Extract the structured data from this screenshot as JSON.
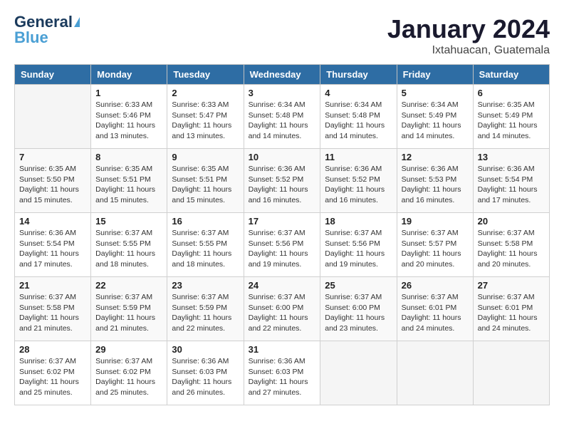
{
  "logo": {
    "line1": "General",
    "line2": "Blue"
  },
  "title": "January 2024",
  "subtitle": "Ixtahuacan, Guatemala",
  "days_of_week": [
    "Sunday",
    "Monday",
    "Tuesday",
    "Wednesday",
    "Thursday",
    "Friday",
    "Saturday"
  ],
  "weeks": [
    [
      {
        "day": "",
        "sunrise": "",
        "sunset": "",
        "daylight": ""
      },
      {
        "day": "1",
        "sunrise": "Sunrise: 6:33 AM",
        "sunset": "Sunset: 5:46 PM",
        "daylight": "Daylight: 11 hours and 13 minutes."
      },
      {
        "day": "2",
        "sunrise": "Sunrise: 6:33 AM",
        "sunset": "Sunset: 5:47 PM",
        "daylight": "Daylight: 11 hours and 13 minutes."
      },
      {
        "day": "3",
        "sunrise": "Sunrise: 6:34 AM",
        "sunset": "Sunset: 5:48 PM",
        "daylight": "Daylight: 11 hours and 14 minutes."
      },
      {
        "day": "4",
        "sunrise": "Sunrise: 6:34 AM",
        "sunset": "Sunset: 5:48 PM",
        "daylight": "Daylight: 11 hours and 14 minutes."
      },
      {
        "day": "5",
        "sunrise": "Sunrise: 6:34 AM",
        "sunset": "Sunset: 5:49 PM",
        "daylight": "Daylight: 11 hours and 14 minutes."
      },
      {
        "day": "6",
        "sunrise": "Sunrise: 6:35 AM",
        "sunset": "Sunset: 5:49 PM",
        "daylight": "Daylight: 11 hours and 14 minutes."
      }
    ],
    [
      {
        "day": "7",
        "sunrise": "Sunrise: 6:35 AM",
        "sunset": "Sunset: 5:50 PM",
        "daylight": "Daylight: 11 hours and 15 minutes."
      },
      {
        "day": "8",
        "sunrise": "Sunrise: 6:35 AM",
        "sunset": "Sunset: 5:51 PM",
        "daylight": "Daylight: 11 hours and 15 minutes."
      },
      {
        "day": "9",
        "sunrise": "Sunrise: 6:35 AM",
        "sunset": "Sunset: 5:51 PM",
        "daylight": "Daylight: 11 hours and 15 minutes."
      },
      {
        "day": "10",
        "sunrise": "Sunrise: 6:36 AM",
        "sunset": "Sunset: 5:52 PM",
        "daylight": "Daylight: 11 hours and 16 minutes."
      },
      {
        "day": "11",
        "sunrise": "Sunrise: 6:36 AM",
        "sunset": "Sunset: 5:52 PM",
        "daylight": "Daylight: 11 hours and 16 minutes."
      },
      {
        "day": "12",
        "sunrise": "Sunrise: 6:36 AM",
        "sunset": "Sunset: 5:53 PM",
        "daylight": "Daylight: 11 hours and 16 minutes."
      },
      {
        "day": "13",
        "sunrise": "Sunrise: 6:36 AM",
        "sunset": "Sunset: 5:54 PM",
        "daylight": "Daylight: 11 hours and 17 minutes."
      }
    ],
    [
      {
        "day": "14",
        "sunrise": "Sunrise: 6:36 AM",
        "sunset": "Sunset: 5:54 PM",
        "daylight": "Daylight: 11 hours and 17 minutes."
      },
      {
        "day": "15",
        "sunrise": "Sunrise: 6:37 AM",
        "sunset": "Sunset: 5:55 PM",
        "daylight": "Daylight: 11 hours and 18 minutes."
      },
      {
        "day": "16",
        "sunrise": "Sunrise: 6:37 AM",
        "sunset": "Sunset: 5:55 PM",
        "daylight": "Daylight: 11 hours and 18 minutes."
      },
      {
        "day": "17",
        "sunrise": "Sunrise: 6:37 AM",
        "sunset": "Sunset: 5:56 PM",
        "daylight": "Daylight: 11 hours and 19 minutes."
      },
      {
        "day": "18",
        "sunrise": "Sunrise: 6:37 AM",
        "sunset": "Sunset: 5:56 PM",
        "daylight": "Daylight: 11 hours and 19 minutes."
      },
      {
        "day": "19",
        "sunrise": "Sunrise: 6:37 AM",
        "sunset": "Sunset: 5:57 PM",
        "daylight": "Daylight: 11 hours and 20 minutes."
      },
      {
        "day": "20",
        "sunrise": "Sunrise: 6:37 AM",
        "sunset": "Sunset: 5:58 PM",
        "daylight": "Daylight: 11 hours and 20 minutes."
      }
    ],
    [
      {
        "day": "21",
        "sunrise": "Sunrise: 6:37 AM",
        "sunset": "Sunset: 5:58 PM",
        "daylight": "Daylight: 11 hours and 21 minutes."
      },
      {
        "day": "22",
        "sunrise": "Sunrise: 6:37 AM",
        "sunset": "Sunset: 5:59 PM",
        "daylight": "Daylight: 11 hours and 21 minutes."
      },
      {
        "day": "23",
        "sunrise": "Sunrise: 6:37 AM",
        "sunset": "Sunset: 5:59 PM",
        "daylight": "Daylight: 11 hours and 22 minutes."
      },
      {
        "day": "24",
        "sunrise": "Sunrise: 6:37 AM",
        "sunset": "Sunset: 6:00 PM",
        "daylight": "Daylight: 11 hours and 22 minutes."
      },
      {
        "day": "25",
        "sunrise": "Sunrise: 6:37 AM",
        "sunset": "Sunset: 6:00 PM",
        "daylight": "Daylight: 11 hours and 23 minutes."
      },
      {
        "day": "26",
        "sunrise": "Sunrise: 6:37 AM",
        "sunset": "Sunset: 6:01 PM",
        "daylight": "Daylight: 11 hours and 24 minutes."
      },
      {
        "day": "27",
        "sunrise": "Sunrise: 6:37 AM",
        "sunset": "Sunset: 6:01 PM",
        "daylight": "Daylight: 11 hours and 24 minutes."
      }
    ],
    [
      {
        "day": "28",
        "sunrise": "Sunrise: 6:37 AM",
        "sunset": "Sunset: 6:02 PM",
        "daylight": "Daylight: 11 hours and 25 minutes."
      },
      {
        "day": "29",
        "sunrise": "Sunrise: 6:37 AM",
        "sunset": "Sunset: 6:02 PM",
        "daylight": "Daylight: 11 hours and 25 minutes."
      },
      {
        "day": "30",
        "sunrise": "Sunrise: 6:36 AM",
        "sunset": "Sunset: 6:03 PM",
        "daylight": "Daylight: 11 hours and 26 minutes."
      },
      {
        "day": "31",
        "sunrise": "Sunrise: 6:36 AM",
        "sunset": "Sunset: 6:03 PM",
        "daylight": "Daylight: 11 hours and 27 minutes."
      },
      {
        "day": "",
        "sunrise": "",
        "sunset": "",
        "daylight": ""
      },
      {
        "day": "",
        "sunrise": "",
        "sunset": "",
        "daylight": ""
      },
      {
        "day": "",
        "sunrise": "",
        "sunset": "",
        "daylight": ""
      }
    ]
  ]
}
